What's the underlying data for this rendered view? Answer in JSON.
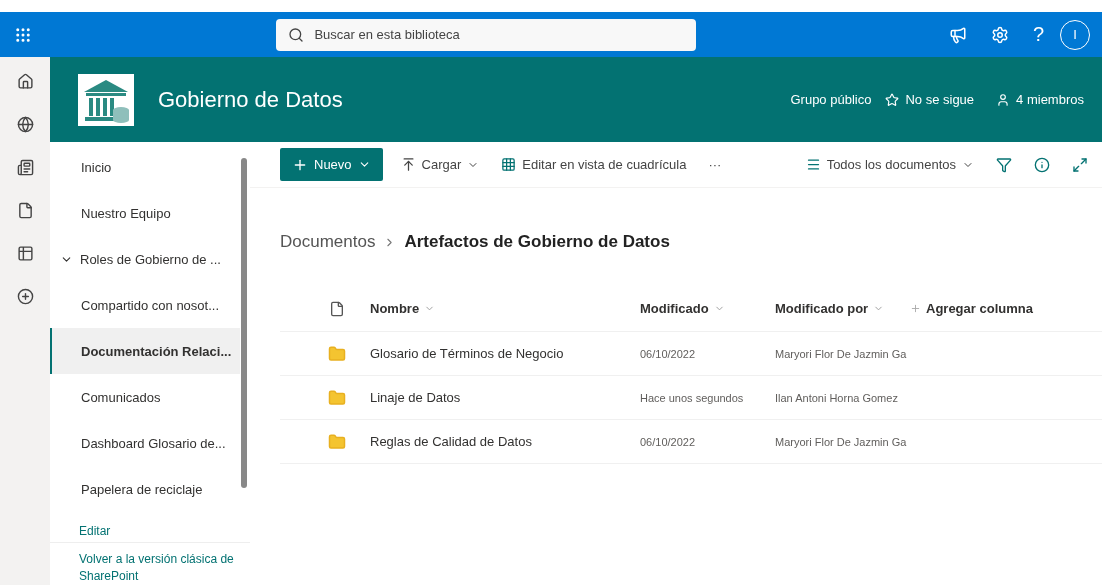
{
  "suite_bar": {
    "search": {
      "placeholder": "Buscar en esta biblioteca"
    },
    "help": "?",
    "avatar": "I"
  },
  "site_header": {
    "title": "Gobierno de Datos",
    "privacy": "Grupo público",
    "follow": "No se sigue",
    "members": "4 miembros"
  },
  "navigation": {
    "items": [
      {
        "label": "Inicio",
        "selected": false,
        "expandable": false
      },
      {
        "label": "Nuestro Equipo",
        "selected": false,
        "expandable": false
      },
      {
        "label": "Roles de Gobierno de ...",
        "selected": false,
        "expandable": true
      },
      {
        "label": "Compartido con nosot...",
        "selected": false,
        "expandable": false
      },
      {
        "label": "Documentación Relaci...",
        "selected": true,
        "expandable": false
      },
      {
        "label": "Comunicados",
        "selected": false,
        "expandable": false
      },
      {
        "label": "Dashboard Glosario de...",
        "selected": false,
        "expandable": false
      },
      {
        "label": "Papelera de reciclaje",
        "selected": false,
        "expandable": false
      }
    ],
    "edit_link": "Editar",
    "classic_link": "Volver a la versión clásica de SharePoint"
  },
  "command_bar": {
    "new": "Nuevo",
    "upload": "Cargar",
    "grid_edit": "Editar en vista de cuadrícula",
    "more": "···",
    "view": "Todos los documentos"
  },
  "breadcrumb": {
    "parent": "Documentos",
    "current": "Artefactos de Gobierno de Datos"
  },
  "table": {
    "columns": [
      "Nombre",
      "Modificado",
      "Modificado por"
    ],
    "add_column": "Agregar columna",
    "rows": [
      {
        "name": "Glosario de Términos de Negocio",
        "modified": "06/10/2022",
        "modified_by": "Maryori Flor De Jazmin Ga"
      },
      {
        "name": "Linaje de Datos",
        "modified": "Hace unos segundos",
        "modified_by": "Ilan Antoni Horna Gomez"
      },
      {
        "name": "Reglas de Calidad de Datos",
        "modified": "06/10/2022",
        "modified_by": "Maryori Flor De Jazmin Ga"
      }
    ]
  }
}
